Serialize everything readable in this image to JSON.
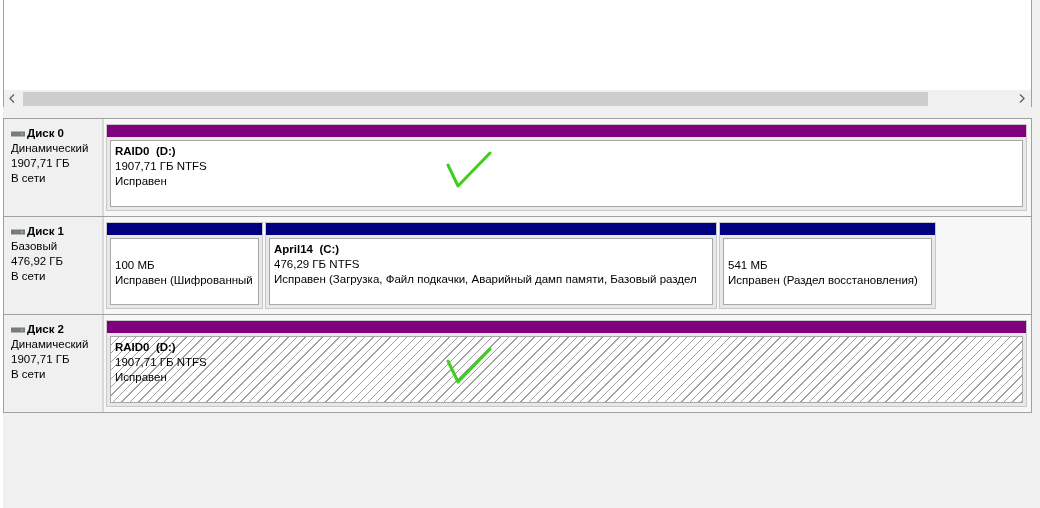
{
  "disks": [
    {
      "name": "Диск 0",
      "type": "Динамический",
      "size": "1907,71 ГБ",
      "status": "В сети",
      "partitions": [
        {
          "color": "#800080",
          "name": "RAID0  (D:)",
          "size": "1907,71 ГБ NTFS",
          "health": "Исправен",
          "selected": false,
          "checkmark": true
        }
      ]
    },
    {
      "name": "Диск 1",
      "type": "Базовый",
      "size": "476,92 ГБ",
      "status": "В сети",
      "partitions": [
        {
          "color": "#000080",
          "size": "100 МБ",
          "health": "Исправен (Шифрованный",
          "selected": false,
          "checkmark": false
        },
        {
          "color": "#000080",
          "name": "April14  (C:)",
          "size": "476,29 ГБ NTFS",
          "health": "Исправен (Загрузка, Файл подкачки, Аварийный дамп памяти, Базовый раздел",
          "selected": false,
          "checkmark": false
        },
        {
          "color": "#000080",
          "size": "541 МБ",
          "health": "Исправен (Раздел восстановления)",
          "selected": false,
          "checkmark": false
        }
      ]
    },
    {
      "name": "Диск 2",
      "type": "Динамический",
      "size": "1907,71 ГБ",
      "status": "В сети",
      "partitions": [
        {
          "color": "#800080",
          "name": "RAID0  (D:)",
          "size": "1907,71 ГБ NTFS",
          "health": "Исправен",
          "selected": true,
          "checkmark": true
        }
      ]
    }
  ]
}
